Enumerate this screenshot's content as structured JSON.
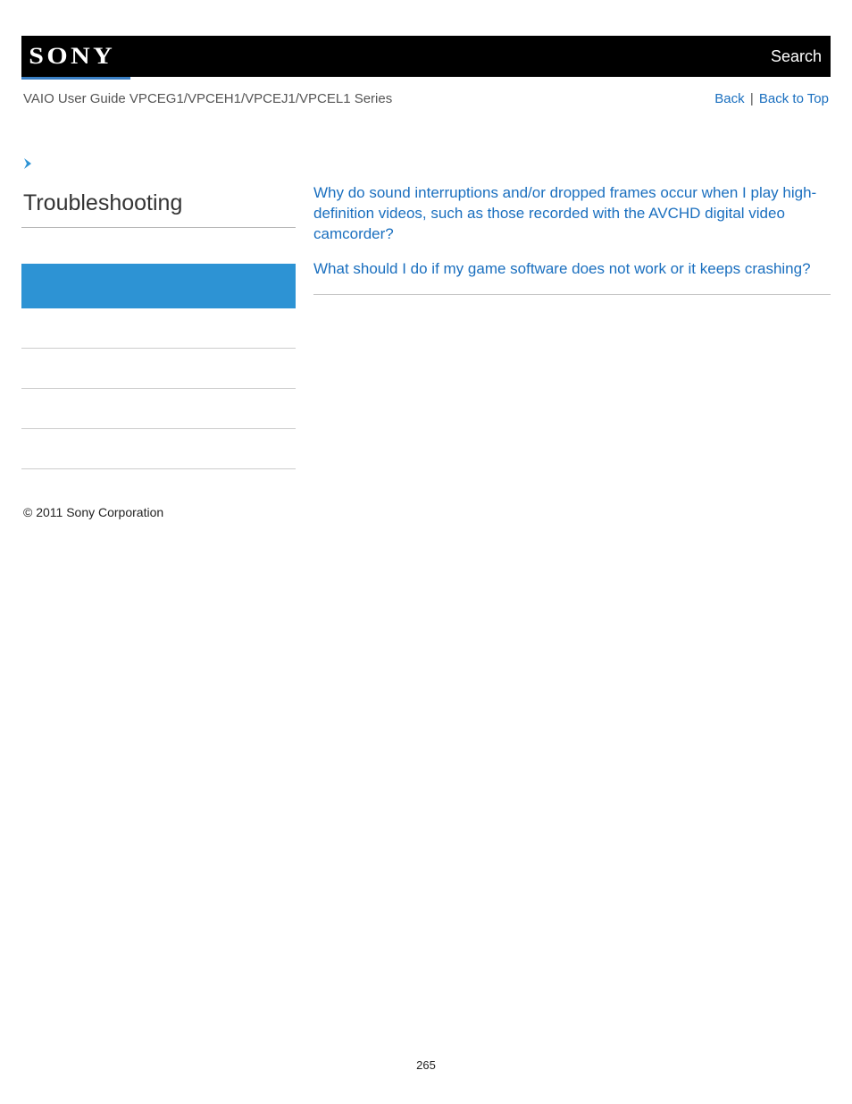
{
  "header": {
    "brand": "SONY",
    "search": "Search"
  },
  "crumb": {
    "guide_title": "VAIO User Guide VPCEG1/VPCEH1/VPCEJ1/VPCEL1 Series",
    "back": "Back",
    "sep": " | ",
    "back_to_top": "Back to Top"
  },
  "sidebar": {
    "title": "Troubleshooting"
  },
  "main": {
    "links": [
      "Why do sound interruptions and/or dropped frames occur when I play high-definition videos, such as those recorded with the AVCHD digital video camcorder?",
      "What should I do if my game software does not work or it keeps crashing?"
    ]
  },
  "footer": {
    "copyright": "© 2011 Sony Corporation",
    "page_number": "265"
  }
}
